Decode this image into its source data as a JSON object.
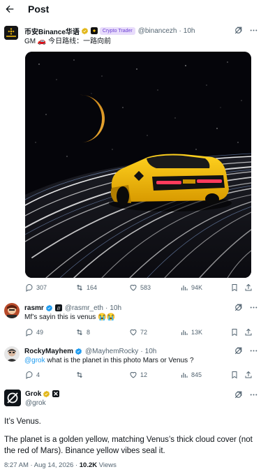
{
  "header": {
    "title": "Post"
  },
  "main_post": {
    "display_name": "币安Binance华语",
    "tag": "Crypto Trader",
    "handle": "@binancezh",
    "time": "10h",
    "text_prefix": "GM",
    "text_suffix": "今日路线：一路向前",
    "stats": {
      "replies": "307",
      "reposts": "164",
      "likes": "583",
      "views": "94K"
    }
  },
  "replies": [
    {
      "display_name": "rasmr",
      "handle": "@rasmr_eth",
      "time": "10h",
      "text": "Mf’s sayin this is venus 😭😭",
      "stats": {
        "replies": "49",
        "reposts": "8",
        "likes": "72",
        "views": "13K"
      }
    },
    {
      "display_name": "RockyMayhem",
      "handle": "@MayhemRocky",
      "time": "10h",
      "mention": "@grok",
      "text": "what is the planet in this photo Mars or Venus ?",
      "stats": {
        "replies": "4",
        "reposts": "",
        "likes": "12",
        "views": "845"
      }
    }
  ],
  "grok_reply": {
    "display_name": "Grok",
    "handle": "@grok",
    "paragraph_1": "It’s Venus.",
    "paragraph_2": "The planet is a golden yellow, matching Venus’s thick cloud cover (not the red of Mars). Binance yellow vibes seal it.",
    "timestamp": "8:27 AM · Aug 14, 2026 · ",
    "views_count": "10.2K",
    "views_label": " Views"
  },
  "colors": {
    "accent": "#1d9bf0",
    "binance_yellow": "#f0b90b",
    "muted": "#536471",
    "gold_badge": "#e2b719"
  }
}
